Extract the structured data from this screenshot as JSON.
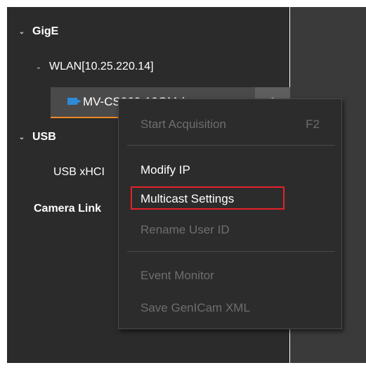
{
  "tree": {
    "gige_label": "GigE",
    "wlan_label": "WLAN[10.25.220.14]",
    "device_label": "MV-CS060-10GM (",
    "usb_label": "USB",
    "usb_xhci_label": "USB xHCI",
    "camera_link_label": "Camera Link"
  },
  "context_menu": {
    "start_acquisition": "Start Acquisition",
    "start_acquisition_shortcut": "F2",
    "modify_ip": "Modify IP",
    "multicast_settings": "Multicast Settings",
    "rename_user_id": "Rename User ID",
    "event_monitor": "Event Monitor",
    "save_genicam_xml": "Save GenICam XML"
  },
  "colors": {
    "panel_bg": "#2b2b2b",
    "menu_bg": "#2c2c2c",
    "accent_underline": "#f08a24",
    "highlight_box": "#e3222a",
    "camera_icon": "#2e8bd6"
  },
  "icons": {
    "expanded": "chevron-down-icon",
    "device": "camera-icon",
    "device_action": "settings-icon"
  }
}
